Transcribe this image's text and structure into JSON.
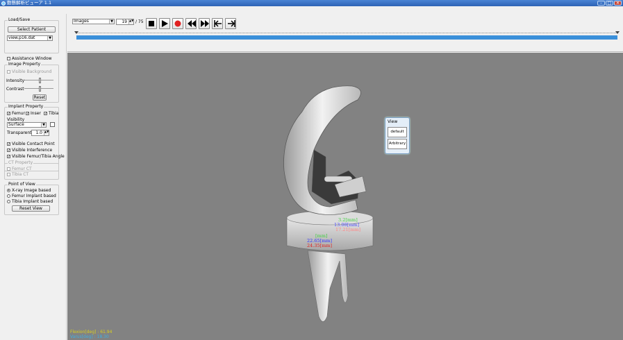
{
  "window": {
    "title": "動態解析ビューア 1.1",
    "buttons": {
      "minimize": "–",
      "maximize": "□",
      "close": "✕"
    }
  },
  "load_save": {
    "group_label": "Load/Save",
    "select_patient_label": "Select Patient",
    "file_selected": "view.p16.dat"
  },
  "assistance_window": {
    "label": "Assistance Window",
    "checked": false
  },
  "image_property": {
    "group_label": "Image Property",
    "visible_background_label": "Visible Background",
    "intensity_label": "Intensity",
    "intensity_value": 0.55,
    "contrast_label": "Contrast",
    "contrast_value": 0.55,
    "reset_label": "Reset"
  },
  "implant_property": {
    "group_label": "Implant Property",
    "femur_label": "Femur",
    "inser_label": "Inser",
    "tibia_label": "Tibia",
    "visibility_label": "Visibility",
    "visibility_value": "Surface",
    "transparent_label": "Transparent",
    "transparent_value": "1.0",
    "visible_contact_point": "Visible Contact Point",
    "visible_interference": "Visible Interference",
    "visible_femur_tibia_angle": "Visible Femur/Tibia Angle"
  },
  "ct_property": {
    "group_label": "CT Property",
    "femur_ct": "Femur CT",
    "tibia_ct": "Tibia CT"
  },
  "point_of_view": {
    "group_label": "Point of View",
    "xray_label": "X-ray Image based",
    "femur_implant_label": "Femur Implant based",
    "tibia_implant_label": "Tibia Implant based",
    "reset_view_label": "Reset View",
    "selected": "X-ray Image based"
  },
  "toolbar": {
    "mode_value": "Images",
    "frame_current": "19",
    "frame_total": "/ 75",
    "progress": 0.253
  },
  "view_popup": {
    "title": "View",
    "default_label": "default",
    "arbitrary_label": "Arbitrary"
  },
  "measurements": {
    "upper_1": "3.2[mm]",
    "upper_2": "13.08[mm]",
    "upper_3": "17.21[mm]",
    "lower_1": "[mm]",
    "lower_2": "22.65[mm]",
    "lower_3": "24.35[mm]"
  },
  "readouts": {
    "flexion": "Flexion[deg] : 61.94",
    "varus": "Varus[deg] : 18.30"
  },
  "colors": {
    "viewport_bg": "#828282",
    "timeline": "#3a8fd9",
    "record": "#e02020",
    "flexion_text": "#d8d020",
    "varus_text": "#40b0e0"
  }
}
